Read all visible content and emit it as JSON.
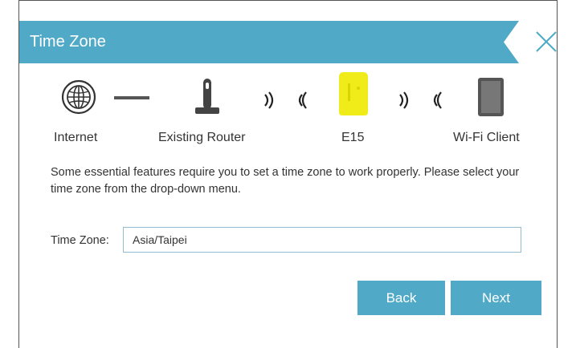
{
  "dialog": {
    "title": "Time Zone",
    "close_icon": "close-icon"
  },
  "topology": {
    "devices": [
      {
        "label": "Internet",
        "icon": "globe-icon"
      },
      {
        "label": "Existing Router",
        "icon": "router-icon"
      },
      {
        "label": "E15",
        "icon": "extender-icon"
      },
      {
        "label": "Wi-Fi Client",
        "icon": "tablet-icon"
      }
    ]
  },
  "description": "Some essential features require you to set a time zone to work properly. Please select your time zone from the drop-down menu.",
  "timezone": {
    "label": "Time Zone:",
    "value": "Asia/Taipei"
  },
  "buttons": {
    "back": "Back",
    "next": "Next"
  },
  "colors": {
    "accent": "#4fa9c7",
    "extender": "#f0ec1a"
  }
}
